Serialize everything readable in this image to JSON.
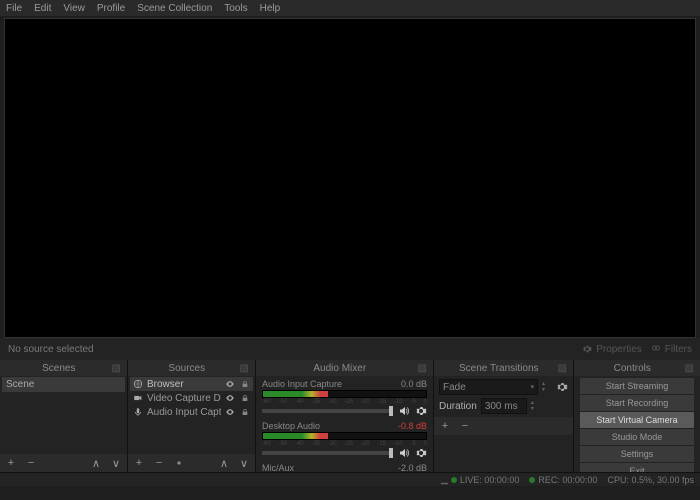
{
  "menubar": [
    "File",
    "Edit",
    "View",
    "Profile",
    "Scene Collection",
    "Tools",
    "Help"
  ],
  "srcbar": {
    "no_source": "No source selected",
    "properties": "Properties",
    "filters": "Filters"
  },
  "panels": {
    "scenes": {
      "title": "Scenes",
      "items": [
        "Scene"
      ]
    },
    "sources": {
      "title": "Sources",
      "items": [
        {
          "name": "Browser",
          "icon": "globe"
        },
        {
          "name": "Video Capture Dev",
          "icon": "camera"
        },
        {
          "name": "Audio Input Capt.",
          "icon": "mic"
        }
      ]
    },
    "mixer": {
      "title": "Audio Mixer",
      "channels": [
        {
          "name": "Audio Input Capture",
          "db": "0.0 dB",
          "red": false,
          "controls": true
        },
        {
          "name": "Desktop Audio",
          "db": "-0.8 dB",
          "red": true,
          "controls": true
        },
        {
          "name": "Mic/Aux",
          "db": "-2.0 dB",
          "red": false,
          "controls": false
        }
      ],
      "ticks": [
        "-60",
        "-50",
        "-40",
        "-35",
        "-30",
        "-25",
        "-20",
        "-15",
        "-10",
        "-5",
        "0"
      ]
    },
    "transitions": {
      "title": "Scene Transitions",
      "select": "Fade",
      "duration_label": "Duration",
      "duration_value": "300 ms"
    },
    "controls": {
      "title": "Controls",
      "buttons": [
        "Start Streaming",
        "Start Recording",
        "Start Virtual Camera",
        "Studio Mode",
        "Settings",
        "Exit"
      ],
      "highlight_index": 2
    }
  },
  "statusbar": {
    "live": "LIVE: 00:00:00",
    "rec": "REC: 00:00:00",
    "cpu": "CPU: 0.5%, 30.00 fps"
  }
}
